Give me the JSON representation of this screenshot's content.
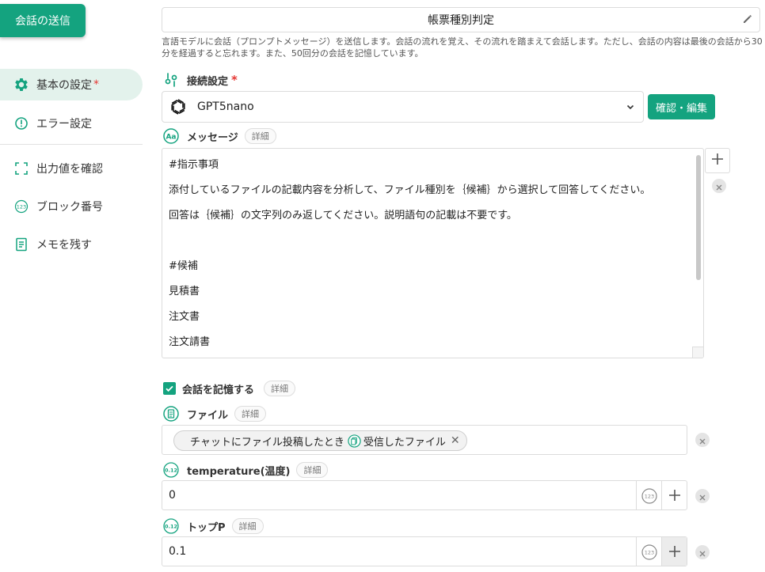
{
  "sidebar": {
    "send_button": "会話の送信",
    "items": [
      {
        "label": "基本の設定",
        "required_mark": "*",
        "icon": "gear-icon"
      },
      {
        "label": "エラー設定",
        "icon": "alert-circle-icon"
      },
      {
        "label": "出力値を確認",
        "icon": "frame-corners-icon"
      },
      {
        "label": "ブロック番号",
        "icon": "number-123-icon"
      },
      {
        "label": "メモを残す",
        "icon": "memo-icon"
      }
    ]
  },
  "header": {
    "title": "帳票種別判定",
    "description": "言語モデルに会話（プロンプトメッセージ）を送信します。会話の流れを覚え、その流れを踏まえて会話します。ただし、会話の内容は最後の会話から30分を経過すると忘れます。また、50回分の会話を記憶しています。"
  },
  "connection": {
    "label": "接続設定",
    "required_mark": "*",
    "model": "GPT5nano",
    "confirm_button": "確認・編集"
  },
  "message": {
    "label": "メッセージ",
    "detail": "詳細",
    "lines": [
      "#指示事項",
      "添付しているファイルの記載内容を分析して、ファイル種別を｛候補｝から選択して回答してください。",
      "回答は｛候補｝の文字列のみ返してください。説明語句の記載は不要です。",
      "",
      "#候補",
      "見積書",
      "注文書",
      "注文請書"
    ]
  },
  "memory": {
    "label": "会話を記憶する",
    "detail": "詳細",
    "checked": true
  },
  "file": {
    "label": "ファイル",
    "detail": "詳細",
    "chip_prefix": "チャットにファイル投稿したとき",
    "chip_value": "受信したファイル",
    "chip_close": "✕"
  },
  "temperature": {
    "label": "temperature(温度)",
    "detail": "詳細",
    "value": "0",
    "badge": "0.12"
  },
  "top_p": {
    "label": "トップP",
    "detail": "詳細",
    "value": "0.1",
    "badge": "0.12"
  },
  "colors": {
    "accent": "#14a37f",
    "required": "#e53935"
  }
}
